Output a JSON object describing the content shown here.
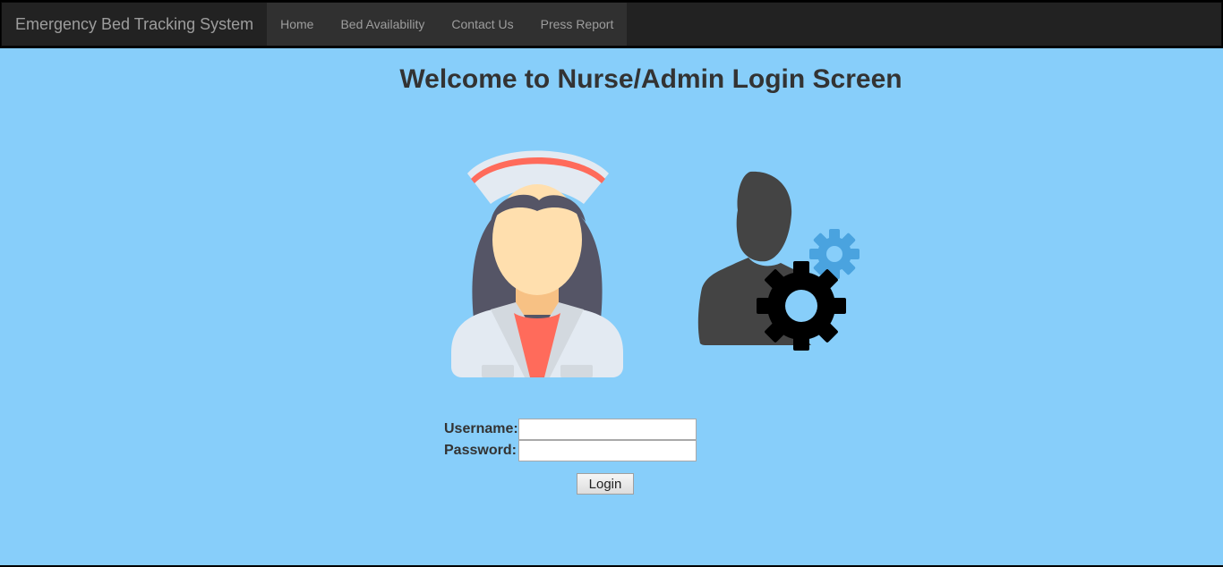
{
  "navbar": {
    "brand": "Emergency Bed Tracking System",
    "items": [
      {
        "label": "Home"
      },
      {
        "label": "Bed Availability"
      },
      {
        "label": "Contact Us"
      },
      {
        "label": "Press Report"
      }
    ]
  },
  "main": {
    "title": "Welcome to Nurse/Admin Login Screen",
    "nurse_image": {
      "icon": "nurse-avatar-icon"
    },
    "admin_image": {
      "icon": "admin-gear-icon"
    }
  },
  "login": {
    "username_label": "Username:",
    "username_value": "",
    "password_label": "Password:",
    "password_value": "",
    "button_label": "Login"
  },
  "colors": {
    "page_background": "#87cefa",
    "navbar_background": "#222222",
    "nurse_cap_stripe": "#ff6b5b",
    "nurse_hair": "#555566",
    "admin_silhouette": "#444444",
    "small_gear": "#4aa3df",
    "big_gear": "#000000"
  }
}
